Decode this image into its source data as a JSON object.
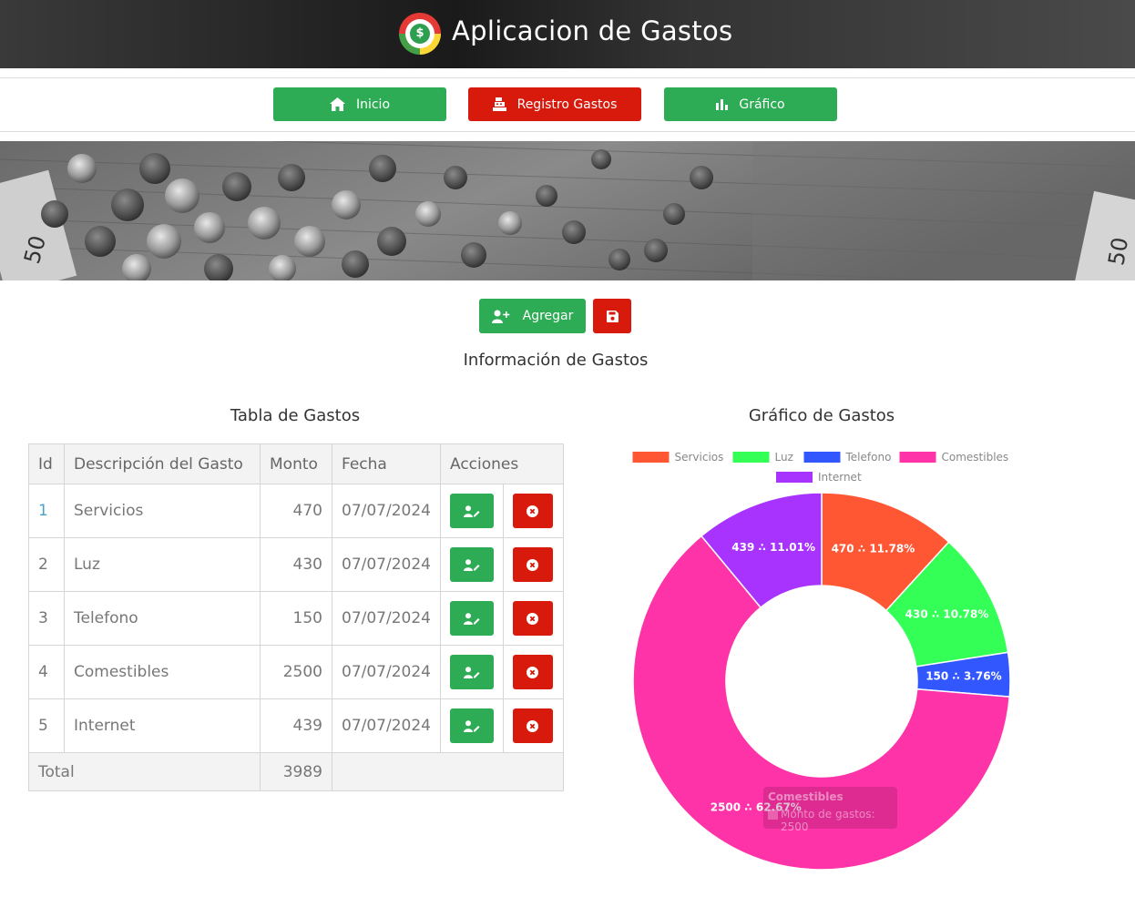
{
  "app": {
    "title": "Aplicacion de Gastos"
  },
  "nav": [
    {
      "label": "Inicio",
      "icon": "home-icon",
      "color": "#2eac55"
    },
    {
      "label": "Registro Gastos",
      "icon": "cash-register-icon",
      "color": "#d71a0c"
    },
    {
      "label": "Gráfico",
      "icon": "bar-chart-icon",
      "color": "#2eac55"
    }
  ],
  "actions": {
    "add_label": "Agregar",
    "save_icon": "save-icon"
  },
  "info_title": "Información de Gastos",
  "table": {
    "title": "Tabla de Gastos",
    "headers": [
      "Id",
      "Descripción del Gasto",
      "Monto",
      "Fecha",
      "Acciones"
    ],
    "rows": [
      {
        "id": "1",
        "desc": "Servicios",
        "amount": "470",
        "date": "07/07/2024"
      },
      {
        "id": "2",
        "desc": "Luz",
        "amount": "430",
        "date": "07/07/2024"
      },
      {
        "id": "3",
        "desc": "Telefono",
        "amount": "150",
        "date": "07/07/2024"
      },
      {
        "id": "4",
        "desc": "Comestibles",
        "amount": "2500",
        "date": "07/07/2024"
      },
      {
        "id": "5",
        "desc": "Internet",
        "amount": "439",
        "date": "07/07/2024"
      }
    ],
    "total_label": "Total",
    "total_value": "3989"
  },
  "chart_title": "Gráfico de Gastos",
  "chart_data": {
    "type": "pie",
    "categories": [
      "Servicios",
      "Luz",
      "Telefono",
      "Comestibles",
      "Internet"
    ],
    "values": [
      470,
      430,
      150,
      2500,
      439
    ],
    "colors": [
      "#ff5733",
      "#33ff57",
      "#3357ff",
      "#ff33a8",
      "#a833ff"
    ],
    "labels": [
      "470 ∴ 11.78%",
      "430 ∴ 10.78%",
      "150 ∴ 3.76%",
      "2500 ∴ 62.67%",
      "439 ∴ 11.01%"
    ],
    "legend_position": "top",
    "doughnut": true
  },
  "tooltip": {
    "title": "Comestibles",
    "body": "Monto de gastos: 2500"
  }
}
